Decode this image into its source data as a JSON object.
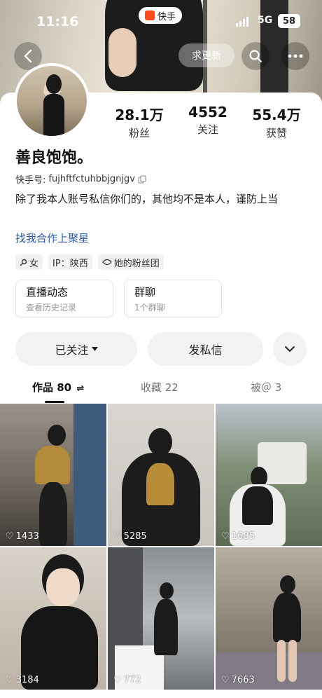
{
  "status_bar": {
    "time": "11:16",
    "app_name": "快手",
    "network": "5G",
    "battery": "58"
  },
  "nav": {
    "update_label": "求更新"
  },
  "profile": {
    "followers_count": "28.1万",
    "followers_label": "粉丝",
    "following_count": "4552",
    "following_label": "关注",
    "likes_count": "55.4万",
    "likes_label": "获赞",
    "name": "善良饱饱。",
    "id_label": "快手号:",
    "id_value": "fujhftfctuhbbjgnjgv",
    "bio": "除了我本人账号私信你们的，其他均不是本人，谨防上当",
    "collab_link": "找我合作上聚星",
    "tags": {
      "gender": "女",
      "ip": "IP：陕西",
      "fan_group": "她的粉丝团"
    }
  },
  "cards": {
    "live": {
      "title": "直播动态",
      "subtitle": "查看历史记录"
    },
    "group": {
      "title": "群聊",
      "subtitle": "1个群聊"
    }
  },
  "actions": {
    "following": "已关注",
    "message": "发私信"
  },
  "tabs": {
    "works": "作品 80",
    "favorites": "收藏 22",
    "mentioned": "被＠ 3"
  },
  "videos": [
    {
      "likes": "1433"
    },
    {
      "likes": "5285"
    },
    {
      "likes": "1685"
    },
    {
      "likes": "3184"
    },
    {
      "likes": "772"
    },
    {
      "likes": "7663"
    }
  ],
  "colors": {
    "link": "#2c5aa8",
    "brand": "#ff4a1c"
  }
}
